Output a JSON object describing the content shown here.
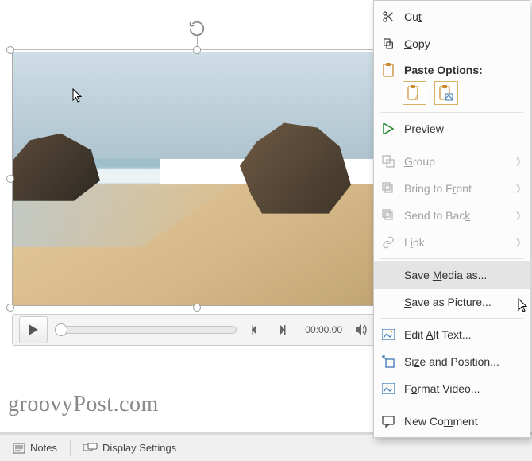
{
  "media": {
    "time": "00:00.00"
  },
  "watermark": "groovyPost.com",
  "statusbar": {
    "notes": "Notes",
    "display_settings": "Display Settings"
  },
  "context_menu": {
    "cut": "Cut",
    "copy": "Copy",
    "paste_options_label": "Paste Options:",
    "preview": "Preview",
    "group": "Group",
    "bring_to_front": "Bring to Front",
    "send_to_back": "Send to Back",
    "link": "Link",
    "save_media_as": "Save Media as...",
    "save_as_picture": "Save as Picture...",
    "edit_alt_text": "Edit Alt Text...",
    "size_and_position": "Size and Position...",
    "format_video": "Format Video...",
    "new_comment": "New Comment"
  }
}
